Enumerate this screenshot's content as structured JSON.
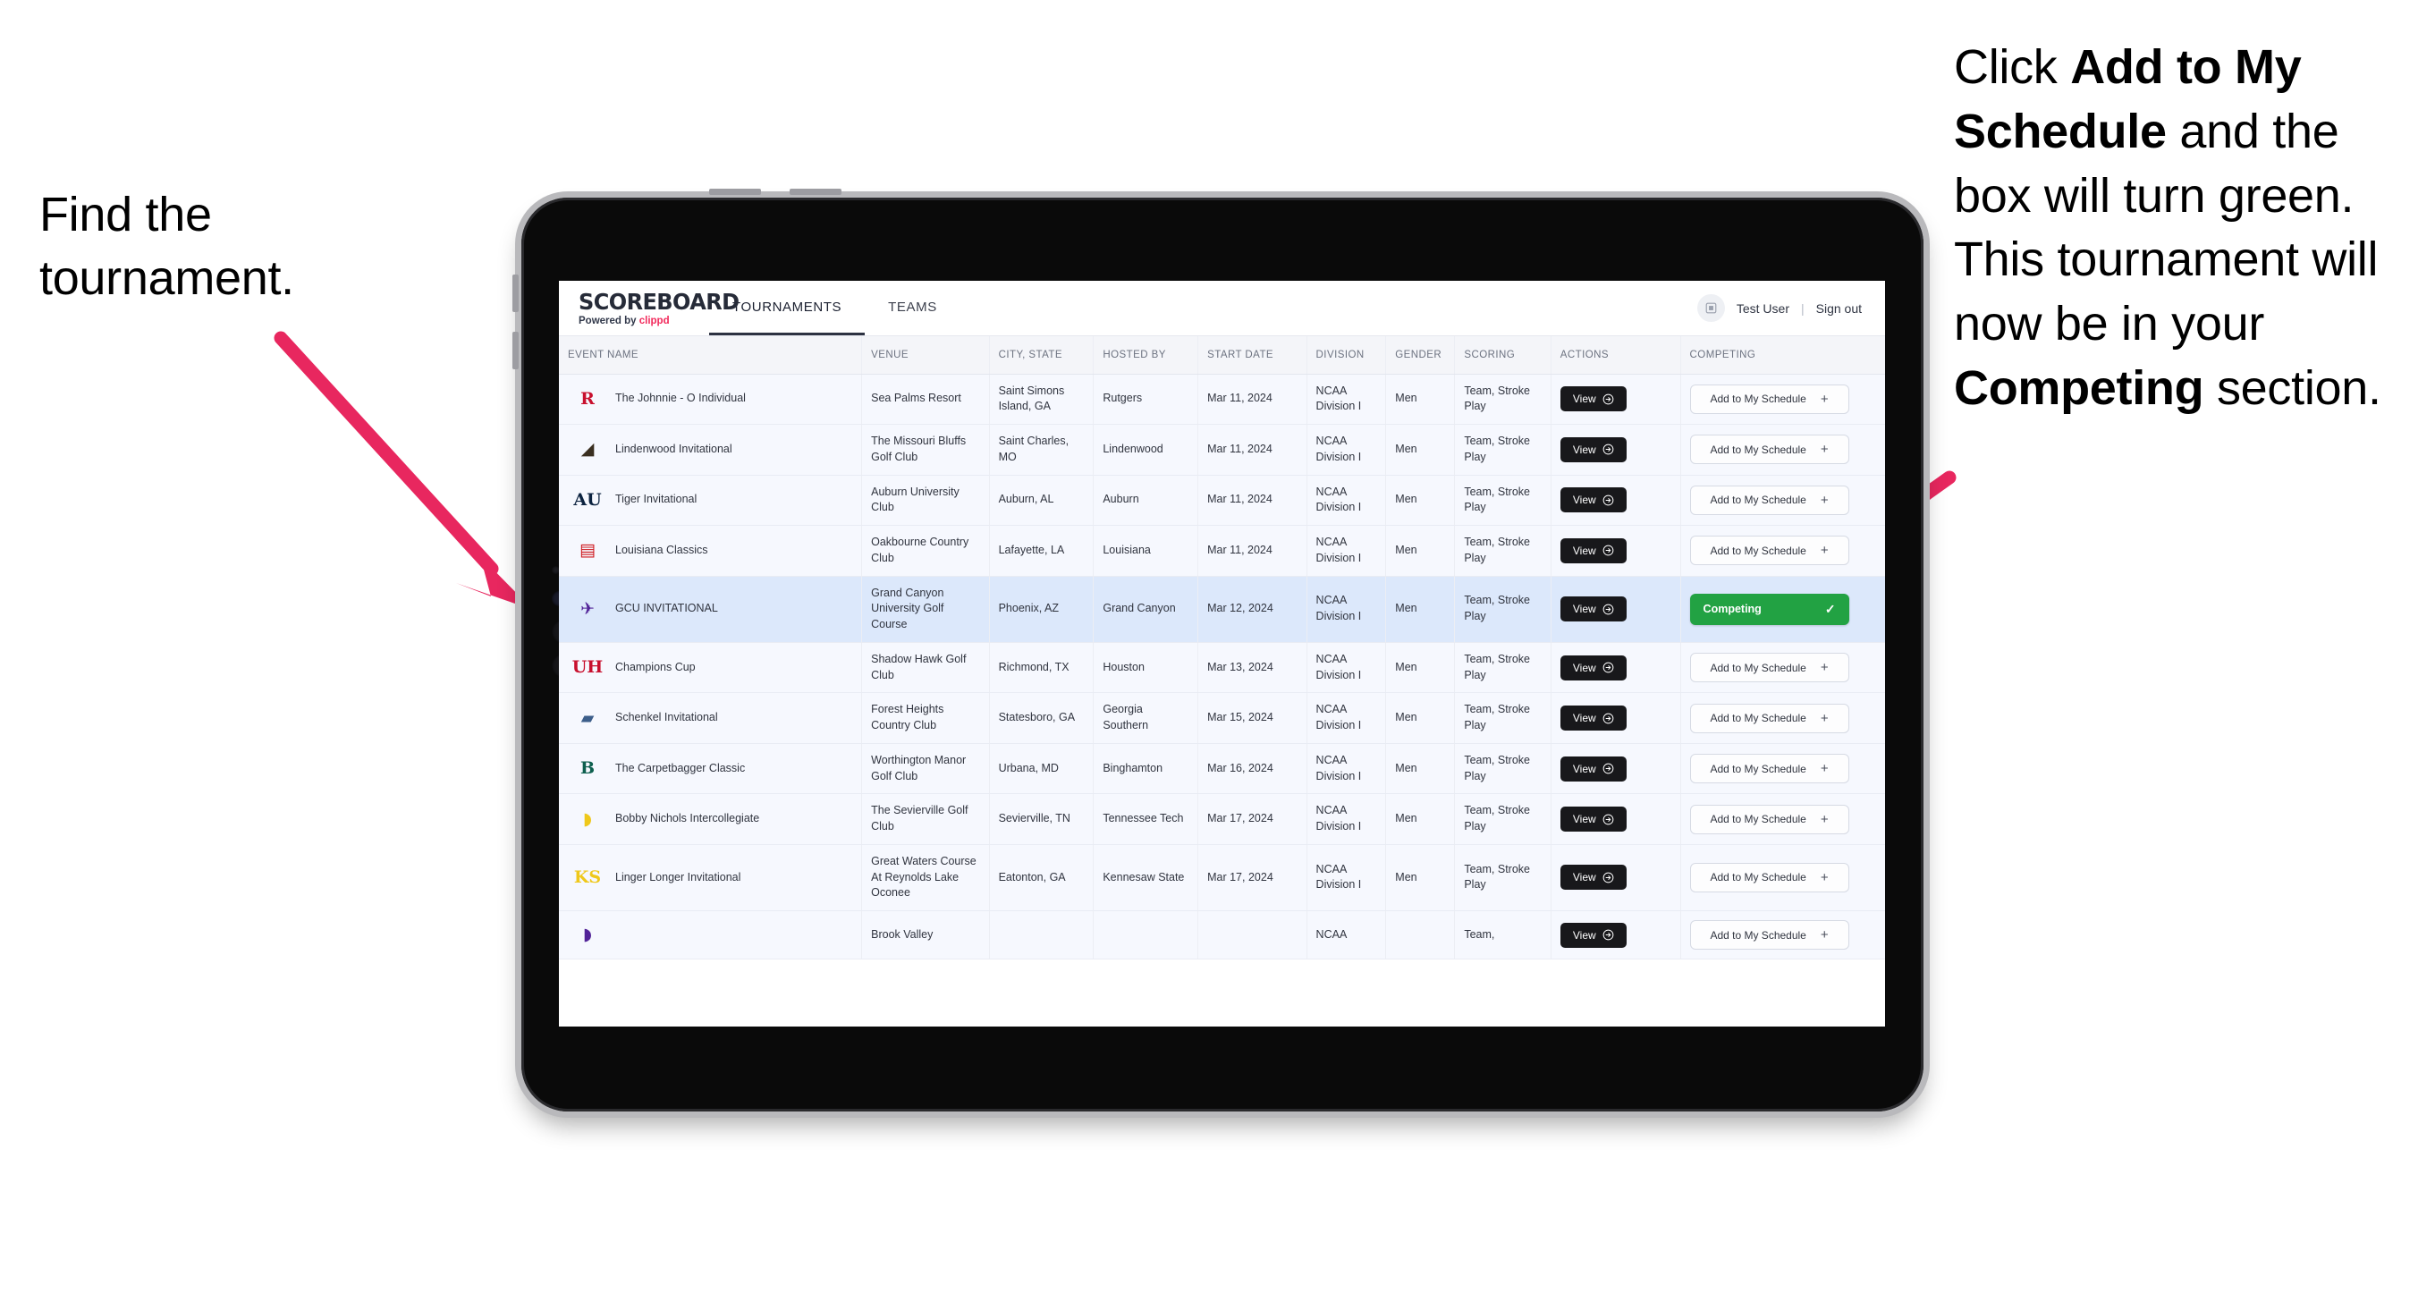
{
  "annotations": {
    "left": "Find the tournament.",
    "right_parts": [
      {
        "text": "Click ",
        "bold": false
      },
      {
        "text": "Add to My Schedule",
        "bold": true
      },
      {
        "text": " and the box will turn green. This tournament will now be in your ",
        "bold": false
      },
      {
        "text": "Competing",
        "bold": true
      },
      {
        "text": " section.",
        "bold": false
      }
    ],
    "arrow_color": "#e8275f"
  },
  "app": {
    "brand": {
      "word": "SCOREBOARD",
      "powered_prefix": "Powered by ",
      "powered_name": "clippd"
    },
    "tabs": [
      {
        "label": "TOURNAMENTS",
        "active": true
      },
      {
        "label": "TEAMS",
        "active": false
      }
    ],
    "user": {
      "avatar_icon": "user-avatar-icon",
      "name": "Test User",
      "separator": "|",
      "signout": "Sign out"
    }
  },
  "table": {
    "columns": [
      "EVENT NAME",
      "VENUE",
      "CITY, STATE",
      "HOSTED BY",
      "START DATE",
      "DIVISION",
      "GENDER",
      "SCORING",
      "ACTIONS",
      "COMPETING"
    ],
    "view_label": "View",
    "add_label": "Add to My Schedule",
    "add_plus": "+",
    "competing_label": "Competing",
    "competing_check": "✓",
    "rows": [
      {
        "logo": "R",
        "logo_color": "#c8102e",
        "logo_font": "serif",
        "event": "The Johnnie - O Individual",
        "venue": "Sea Palms Resort",
        "city": "Saint Simons Island, GA",
        "host": "Rutgers",
        "date": "Mar 11, 2024",
        "division": "NCAA Division I",
        "gender": "Men",
        "scoring": "Team, Stroke Play",
        "competing": false,
        "highlight": false
      },
      {
        "logo": "◢",
        "logo_color": "#3a2f20",
        "logo_font": "sans",
        "event": "Lindenwood Invitational",
        "venue": "The Missouri Bluffs Golf Club",
        "city": "Saint Charles, MO",
        "host": "Lindenwood",
        "date": "Mar 11, 2024",
        "division": "NCAA Division I",
        "gender": "Men",
        "scoring": "Team, Stroke Play",
        "competing": false,
        "highlight": false
      },
      {
        "logo": "AU",
        "logo_color": "#0c2340",
        "logo_font": "serif",
        "event": "Tiger Invitational",
        "venue": "Auburn University Club",
        "city": "Auburn, AL",
        "host": "Auburn",
        "date": "Mar 11, 2024",
        "division": "NCAA Division I",
        "gender": "Men",
        "scoring": "Team, Stroke Play",
        "competing": false,
        "highlight": false
      },
      {
        "logo": "▤",
        "logo_color": "#ce181e",
        "logo_font": "sans",
        "event": "Louisiana Classics",
        "venue": "Oakbourne Country Club",
        "city": "Lafayette, LA",
        "host": "Louisiana",
        "date": "Mar 11, 2024",
        "division": "NCAA Division I",
        "gender": "Men",
        "scoring": "Team, Stroke Play",
        "competing": false,
        "highlight": false
      },
      {
        "logo": "✈",
        "logo_color": "#522398",
        "logo_font": "sans",
        "event": "GCU INVITATIONAL",
        "venue": "Grand Canyon University Golf Course",
        "city": "Phoenix, AZ",
        "host": "Grand Canyon",
        "date": "Mar 12, 2024",
        "division": "NCAA Division I",
        "gender": "Men",
        "scoring": "Team, Stroke Play",
        "competing": true,
        "highlight": true
      },
      {
        "logo": "UH",
        "logo_color": "#c8102e",
        "logo_font": "serif",
        "event": "Champions Cup",
        "venue": "Shadow Hawk Golf Club",
        "city": "Richmond, TX",
        "host": "Houston",
        "date": "Mar 13, 2024",
        "division": "NCAA Division I",
        "gender": "Men",
        "scoring": "Team, Stroke Play",
        "competing": false,
        "highlight": false
      },
      {
        "logo": "▰",
        "logo_color": "#3c5e8a",
        "logo_font": "sans",
        "event": "Schenkel Invitational",
        "venue": "Forest Heights Country Club",
        "city": "Statesboro, GA",
        "host": "Georgia Southern",
        "date": "Mar 15, 2024",
        "division": "NCAA Division I",
        "gender": "Men",
        "scoring": "Team, Stroke Play",
        "competing": false,
        "highlight": false
      },
      {
        "logo": "B",
        "logo_color": "#0d5f4e",
        "logo_font": "serif",
        "event": "The Carpetbagger Classic",
        "venue": "Worthington Manor Golf Club",
        "city": "Urbana, MD",
        "host": "Binghamton",
        "date": "Mar 16, 2024",
        "division": "NCAA Division I",
        "gender": "Men",
        "scoring": "Team, Stroke Play",
        "competing": false,
        "highlight": false
      },
      {
        "logo": "◗",
        "logo_color": "#efc81a",
        "logo_font": "sans",
        "event": "Bobby Nichols Intercollegiate",
        "venue": "The Sevierville Golf Club",
        "city": "Sevierville, TN",
        "host": "Tennessee Tech",
        "date": "Mar 17, 2024",
        "division": "NCAA Division I",
        "gender": "Men",
        "scoring": "Team, Stroke Play",
        "competing": false,
        "highlight": false
      },
      {
        "logo": "KS",
        "logo_color": "#efc81a",
        "logo_font": "serif",
        "event": "Linger Longer Invitational",
        "venue": "Great Waters Course At Reynolds Lake Oconee",
        "city": "Eatonton, GA",
        "host": "Kennesaw State",
        "date": "Mar 17, 2024",
        "division": "NCAA Division I",
        "gender": "Men",
        "scoring": "Team, Stroke Play",
        "competing": false,
        "highlight": false
      },
      {
        "logo": "◗",
        "logo_color": "#522398",
        "logo_font": "sans",
        "event": "",
        "venue": "Brook Valley",
        "city": "",
        "host": "",
        "date": "",
        "division": "NCAA",
        "gender": "",
        "scoring": "Team,",
        "competing": false,
        "highlight": false,
        "partial": true
      }
    ]
  }
}
